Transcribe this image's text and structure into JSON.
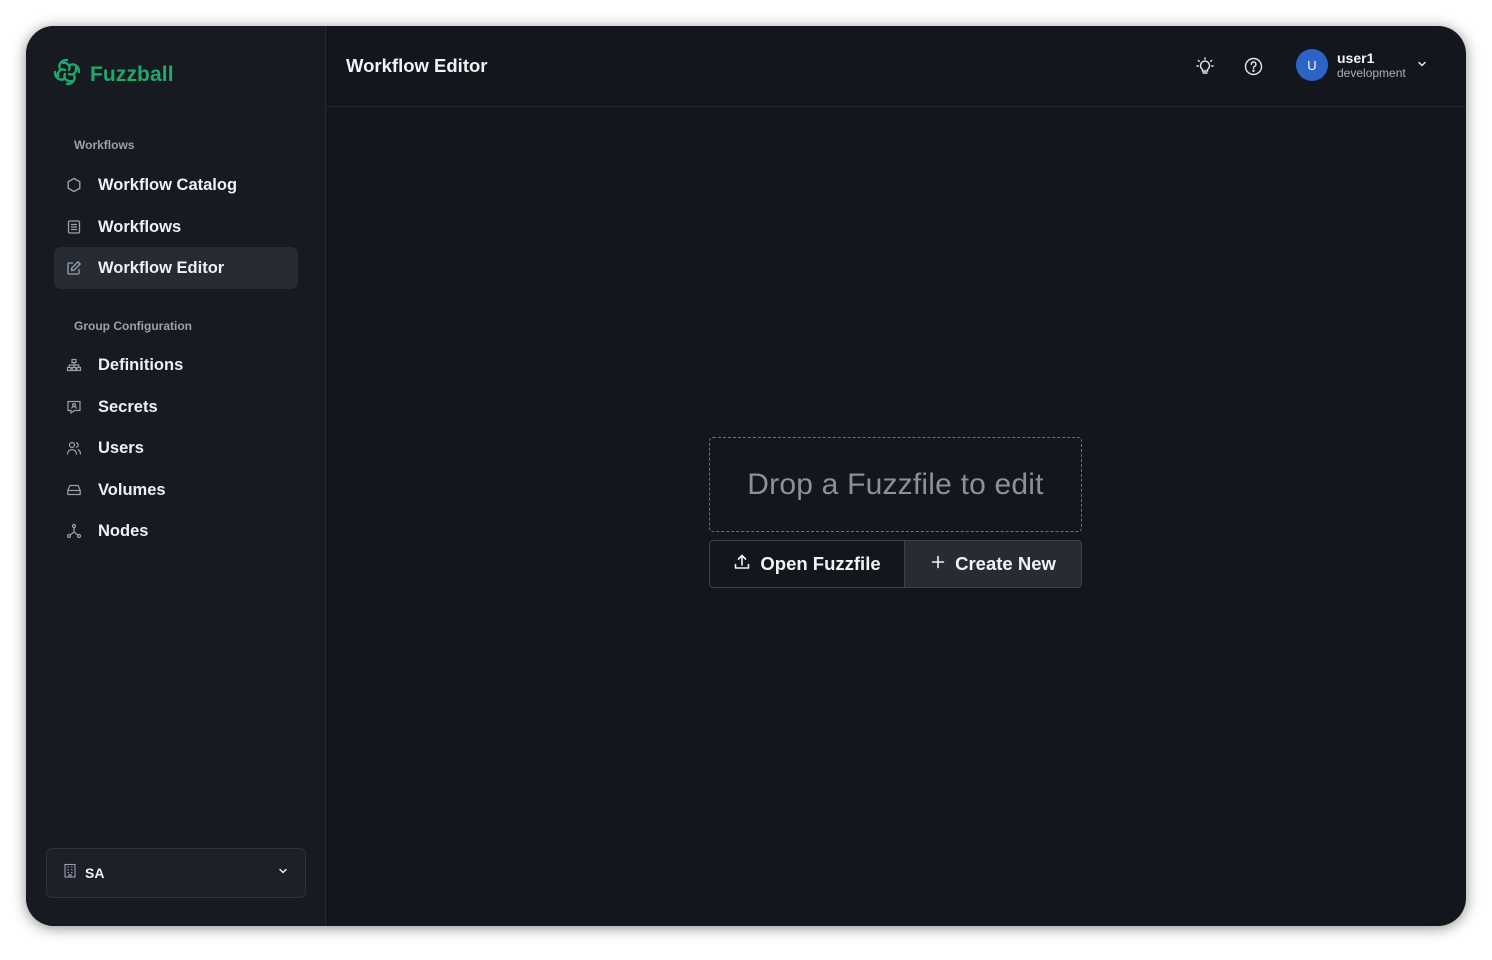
{
  "app": {
    "name": "Fuzzball",
    "brand_color": "#1ea86a"
  },
  "sidebar": {
    "sections": [
      {
        "label": "Workflows",
        "items": [
          {
            "label": "Workflow Catalog",
            "icon": "hexagon-icon"
          },
          {
            "label": "Workflows",
            "icon": "list-icon"
          },
          {
            "label": "Workflow Editor",
            "icon": "edit-icon",
            "active": true
          }
        ]
      },
      {
        "label": "Group Configuration",
        "items": [
          {
            "label": "Definitions",
            "icon": "sitemap-icon"
          },
          {
            "label": "Secrets",
            "icon": "secret-icon"
          },
          {
            "label": "Users",
            "icon": "users-icon"
          },
          {
            "label": "Volumes",
            "icon": "drive-icon"
          },
          {
            "label": "Nodes",
            "icon": "nodes-icon"
          }
        ]
      }
    ],
    "group_select": {
      "label": "SA",
      "icon": "building-icon"
    }
  },
  "header": {
    "title": "Workflow Editor",
    "theme_icon": "lightbulb-icon",
    "help_icon": "help-icon",
    "user": {
      "initial": "U",
      "name": "user1",
      "environment": "development",
      "avatar_color": "#2b63c6"
    }
  },
  "editor": {
    "dropzone_text": "Drop a Fuzzfile to edit",
    "open_button": "Open Fuzzfile",
    "create_button": "Create New"
  }
}
